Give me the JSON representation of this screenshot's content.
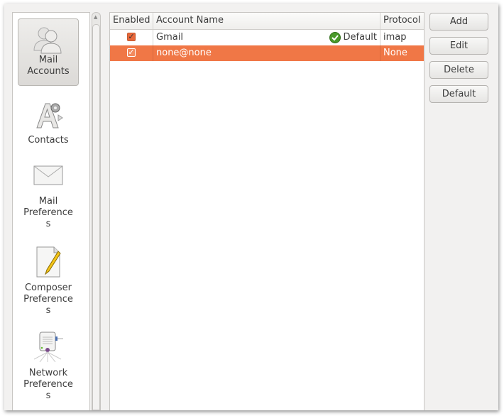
{
  "sidebar": {
    "items": [
      {
        "label_lines": [
          "Mail",
          "Accounts"
        ],
        "icon": "users-icon",
        "selected": true
      },
      {
        "label_lines": [
          "Contacts"
        ],
        "icon": "contacts-icon"
      },
      {
        "label_lines": [
          "Mail",
          "Preference",
          "s"
        ],
        "icon": "envelope-icon"
      },
      {
        "label_lines": [
          "Composer",
          "Preference",
          "s"
        ],
        "icon": "document-pencil-icon"
      },
      {
        "label_lines": [
          "Network",
          "Preference",
          "s"
        ],
        "icon": "network-server-icon"
      }
    ]
  },
  "table": {
    "columns": [
      "Enabled",
      "Account Name",
      "Protocol"
    ],
    "rows": [
      {
        "enabled": true,
        "name": "Gmail",
        "default_label": "Default",
        "protocol": "imap",
        "selected": false
      },
      {
        "enabled": true,
        "name": "none@none",
        "default_label": "",
        "protocol": "None",
        "selected": true
      }
    ]
  },
  "buttons": {
    "add": "Add",
    "edit": "Edit",
    "delete": "Delete",
    "default": "Default"
  },
  "colors": {
    "selection": "#f07746",
    "default_check": "#4a9a2a"
  }
}
